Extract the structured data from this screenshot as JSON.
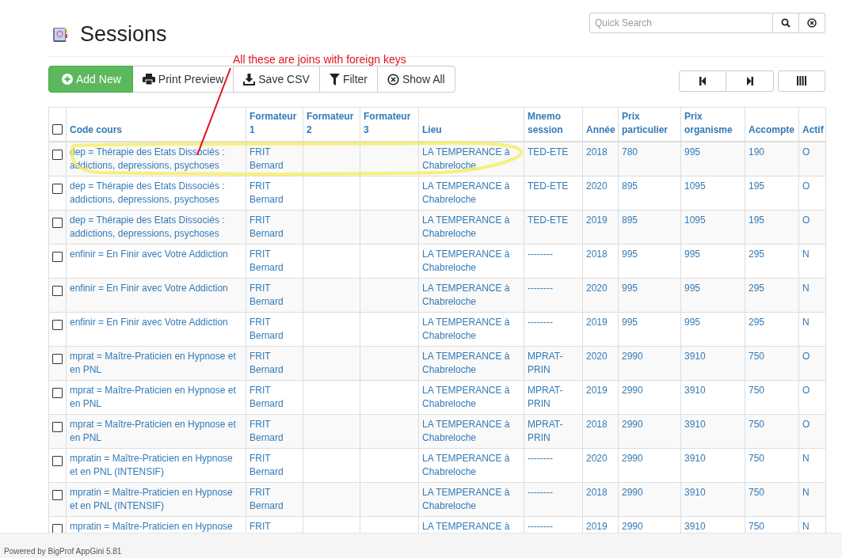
{
  "title": "Sessions",
  "search": {
    "placeholder": "Quick Search"
  },
  "toolbar": [
    {
      "label": "Add New",
      "kind": "add"
    },
    {
      "label": "Print Preview",
      "kind": "print"
    },
    {
      "label": "Save CSV",
      "kind": "download"
    },
    {
      "label": "Filter",
      "kind": "filter"
    },
    {
      "label": "Show All",
      "kind": "clear"
    }
  ],
  "annotation": {
    "text": "All these are joins with foreign keys"
  },
  "table": {
    "select_all": {
      "checked": false
    },
    "columns": [
      "Code cours",
      "Formateur 1",
      "Formateur 2",
      "Formateur 3",
      "Lieu",
      "Mnemo session",
      "Année",
      "Prix particulier",
      "Prix organisme",
      "Accompte",
      "Actif"
    ],
    "rows": [
      {
        "checked": false,
        "cells": [
          "dep = Thérapie des Etats Dissociés : addictions, depressions, psychoses",
          "FRIT Bernard",
          "",
          "",
          "LA TEMPERANCE à Chabreloche",
          "TED-ETE",
          "2018",
          "780",
          "995",
          "190",
          "O"
        ]
      },
      {
        "checked": false,
        "cells": [
          "dep = Thérapie des Etats Dissociés : addictions, depressions, psychoses",
          "FRIT Bernard",
          "",
          "",
          "LA TEMPERANCE à Chabreloche",
          "TED-ETE",
          "2020",
          "895",
          "1095",
          "195",
          "O"
        ]
      },
      {
        "checked": false,
        "cells": [
          "dep = Thérapie des Etats Dissociés : addictions, depressions, psychoses",
          "FRIT Bernard",
          "",
          "",
          "LA TEMPERANCE à Chabreloche",
          "TED-ETE",
          "2019",
          "895",
          "1095",
          "195",
          "O"
        ]
      },
      {
        "checked": false,
        "cells": [
          "enfinir = En Finir avec Votre Addiction",
          "FRIT Bernard",
          "",
          "",
          "LA TEMPERANCE à Chabreloche",
          "--------",
          "2018",
          "995",
          "995",
          "295",
          "N"
        ]
      },
      {
        "checked": false,
        "cells": [
          "enfinir = En Finir avec Votre Addiction",
          "FRIT Bernard",
          "",
          "",
          "LA TEMPERANCE à Chabreloche",
          "--------",
          "2020",
          "995",
          "995",
          "295",
          "N"
        ]
      },
      {
        "checked": false,
        "cells": [
          "enfinir = En Finir avec Votre Addiction",
          "FRIT Bernard",
          "",
          "",
          "LA TEMPERANCE à Chabreloche",
          "--------",
          "2019",
          "995",
          "995",
          "295",
          "N"
        ]
      },
      {
        "checked": false,
        "cells": [
          "mprat = Maître-Praticien en Hypnose et en PNL",
          "FRIT Bernard",
          "",
          "",
          "LA TEMPERANCE à Chabreloche",
          "MPRAT-PRIN",
          "2020",
          "2990",
          "3910",
          "750",
          "O"
        ]
      },
      {
        "checked": false,
        "cells": [
          "mprat = Maître-Praticien en Hypnose et en PNL",
          "FRIT Bernard",
          "",
          "",
          "LA TEMPERANCE à Chabreloche",
          "MPRAT-PRIN",
          "2019",
          "2990",
          "3910",
          "750",
          "O"
        ]
      },
      {
        "checked": false,
        "cells": [
          "mprat = Maître-Praticien en Hypnose et en PNL",
          "FRIT Bernard",
          "",
          "",
          "LA TEMPERANCE à Chabreloche",
          "MPRAT-PRIN",
          "2018",
          "2990",
          "3910",
          "750",
          "O"
        ]
      },
      {
        "checked": false,
        "cells": [
          "mpratin = Maître-Praticien en Hypnose et en PNL (INTENSIF)",
          "FRIT Bernard",
          "",
          "",
          "LA TEMPERANCE à Chabreloche",
          "--------",
          "2020",
          "2990",
          "3910",
          "750",
          "N"
        ]
      },
      {
        "checked": false,
        "cells": [
          "mpratin = Maître-Praticien en Hypnose et en PNL (INTENSIF)",
          "FRIT Bernard",
          "",
          "",
          "LA TEMPERANCE à Chabreloche",
          "--------",
          "2018",
          "2990",
          "3910",
          "750",
          "N"
        ]
      },
      {
        "checked": false,
        "cells": [
          "mpratin = Maître-Praticien en Hypnose",
          "FRIT",
          "",
          "",
          "LA TEMPERANCE à",
          "--------",
          "2019",
          "2990",
          "3910",
          "750",
          "N"
        ]
      }
    ]
  },
  "footer": {
    "text": "Powered by BigProf AppGini 5.81"
  }
}
